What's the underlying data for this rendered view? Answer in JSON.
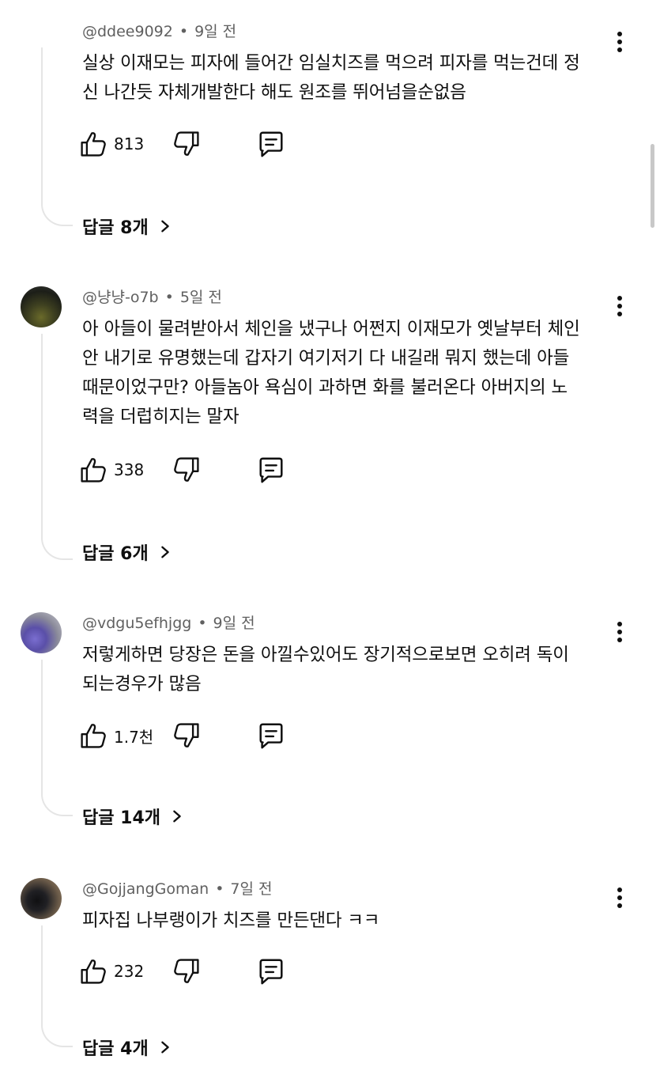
{
  "comments": [
    {
      "handle": "@ddee9092",
      "time": "9일 전",
      "lines": [
        "실상 이재모는 피자에 들어간 임실치즈를 먹으려 피자를 먹는건데 정",
        "신 나간듯 자체개발한다 해도 원조를 뛰어넘을순없음"
      ],
      "likes": "813",
      "replies_label": "답글 8개",
      "avatar": "none"
    },
    {
      "handle": "@냥냥-o7b",
      "time": "5일 전",
      "lines": [
        "아 아들이 물려받아서 체인을 냈구나 어쩐지 이재모가 옛날부터 체인",
        "안 내기로 유명했는데 갑자기 여기저기 다 내길래 뭐지 했는데 아들",
        "때문이었구만? 아들놈아 욕심이 과하면 화를 불러온다 아버지의 노",
        "력을 더럽히지는 말자"
      ],
      "likes": "338",
      "replies_label": "답글 6개",
      "avatar": "dark-olive"
    },
    {
      "handle": "@vdgu5efhjgg",
      "time": "9일 전",
      "lines": [
        "저렇게하면 당장은 돈을 아낄수있어도 장기적으로보면 오히려 독이",
        "되는경우가 많음"
      ],
      "likes": "1.7천",
      "replies_label": "답글 14개",
      "avatar": "purple-flower"
    },
    {
      "handle": "@GojjangGoman",
      "time": "7일 전",
      "lines": [
        "피자집 나부랭이가 치즈를 만든댄다 ㅋㅋ"
      ],
      "likes": "232",
      "replies_label": "답글 4개",
      "avatar": "dark-figure"
    }
  ],
  "icons": {
    "like": "thumbs-up-icon",
    "dislike": "thumbs-down-icon",
    "reply": "comment-icon",
    "more": "more-vert-icon",
    "chevron": "chevron-right-icon"
  },
  "colors": {
    "text": "#0f0f0f",
    "meta": "#606060",
    "thread_line": "#e5e5e5"
  }
}
